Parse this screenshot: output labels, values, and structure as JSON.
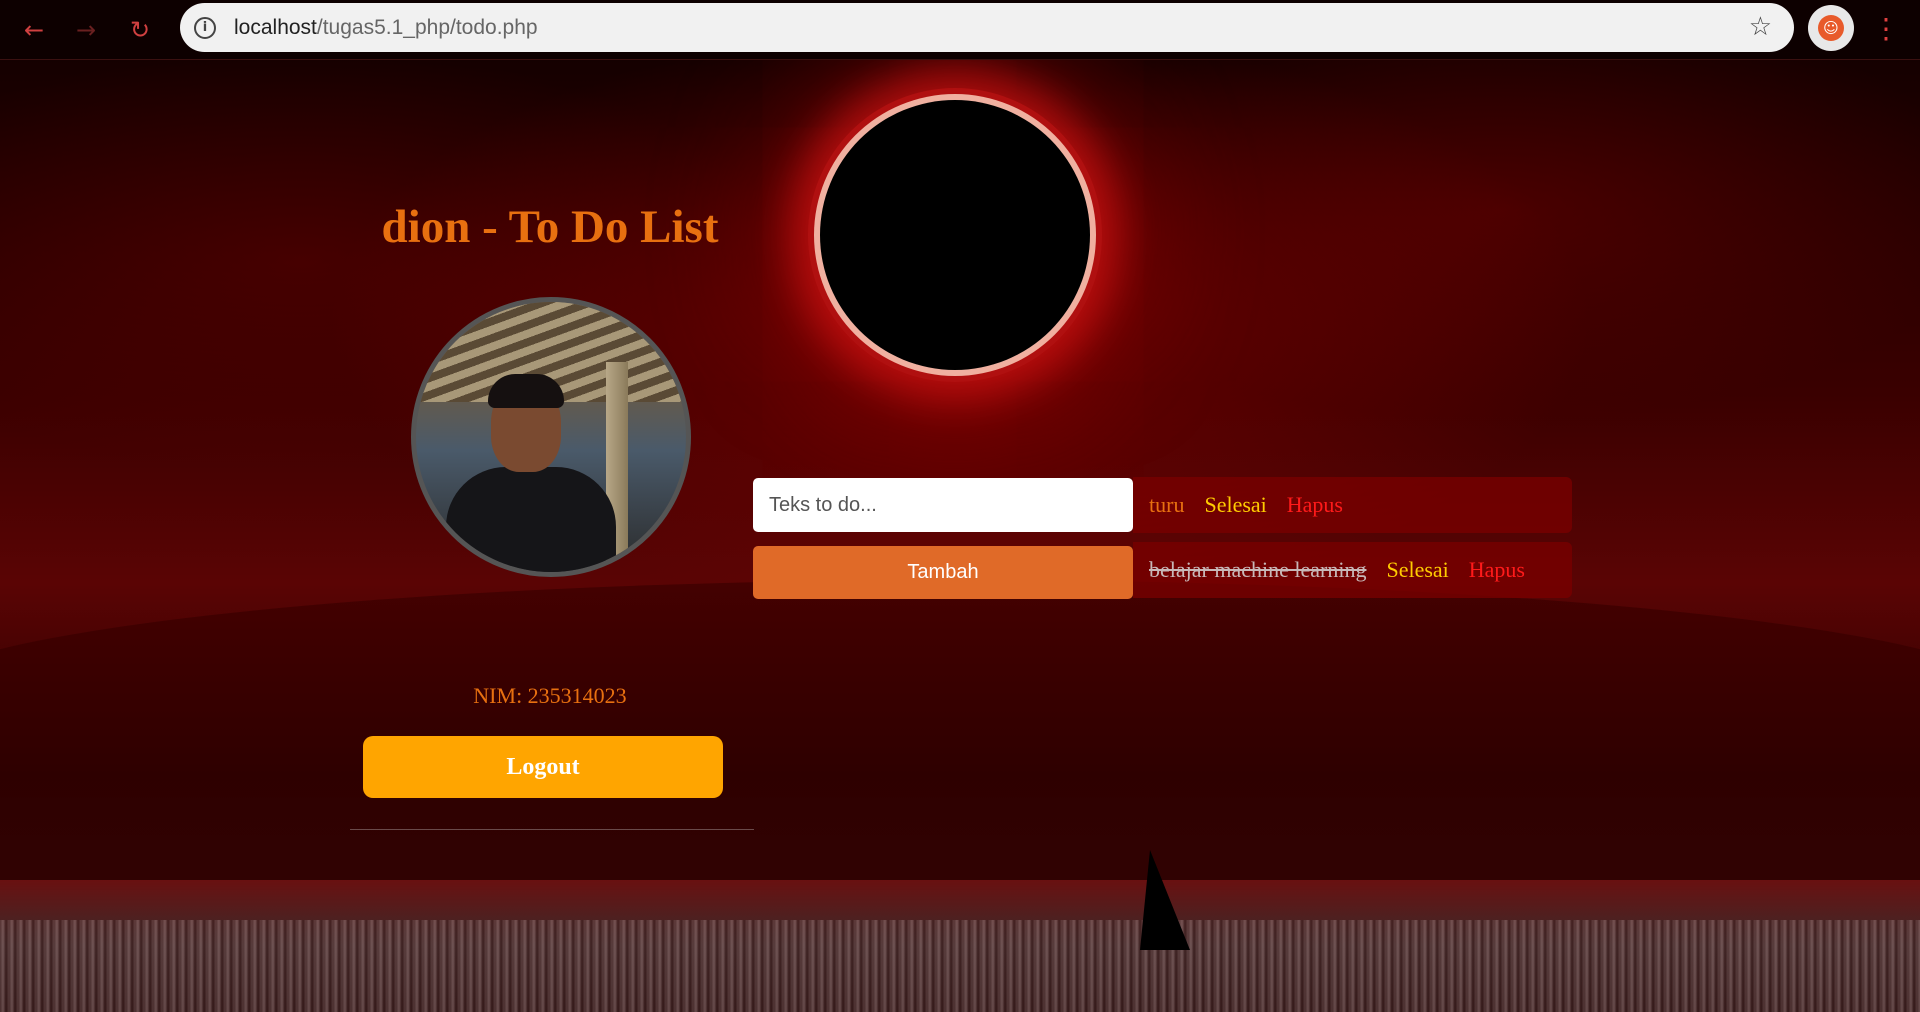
{
  "browser": {
    "url_host": "localhost",
    "url_path": "/tugas5.1_php/todo.php",
    "icons": {
      "back": "arrow-left-icon",
      "forward": "arrow-right-icon",
      "reload": "reload-icon",
      "site_info": "info-icon",
      "bookmark": "star-icon",
      "profile": "profile-icon",
      "menu": "kebab-menu-icon"
    }
  },
  "header": {
    "title": "dion - To Do List"
  },
  "profile": {
    "nim": "NIM: 235314023",
    "logout_label": "Logout"
  },
  "form": {
    "placeholder": "Teks to do...",
    "value": "",
    "add_label": "Tambah"
  },
  "todos": [
    {
      "text": "turu",
      "done": false,
      "done_label": "Selesai",
      "delete_label": "Hapus"
    },
    {
      "text": "belajar machine learning",
      "done": true,
      "done_label": "Selesai",
      "delete_label": "Hapus"
    }
  ],
  "colors": {
    "title": "#e87010",
    "logout_button": "#ffa500",
    "add_button": "#e06a28",
    "done_link": "#ffcc00",
    "delete_link": "#ff1a1a"
  }
}
